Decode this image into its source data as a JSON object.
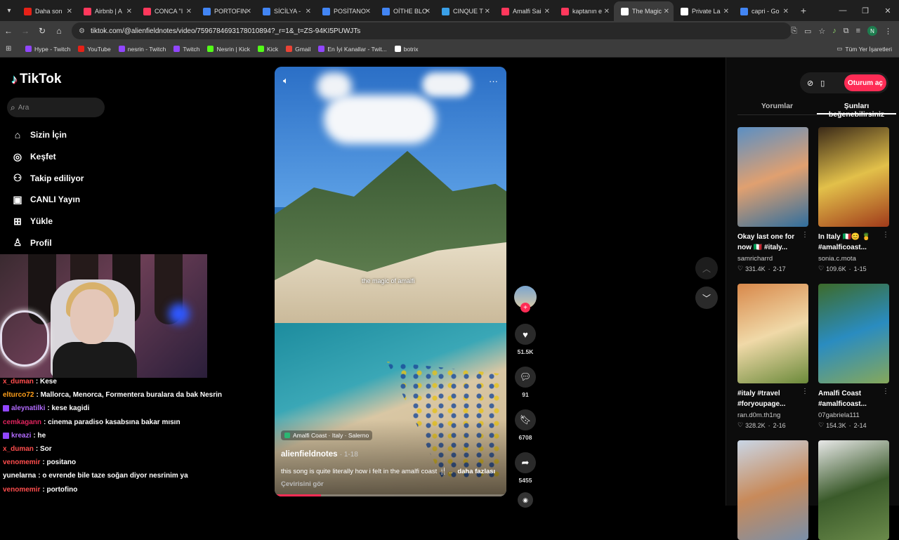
{
  "browser": {
    "tabs": [
      {
        "title": "Daha son",
        "color": "#e62117"
      },
      {
        "title": "Airbnb | A",
        "color": "#ff385c"
      },
      {
        "title": "CONCA \"I",
        "color": "#ff385c"
      },
      {
        "title": "PORTOFIN",
        "color": "#4285f4"
      },
      {
        "title": "SİCİLYA -",
        "color": "#4285f4"
      },
      {
        "title": "POSİTANO",
        "color": "#4285f4"
      },
      {
        "title": "OİTHE BLO",
        "color": "#4285f4"
      },
      {
        "title": "CINQUE T",
        "color": "#3aa0e8"
      },
      {
        "title": "Amalfi Sai",
        "color": "#ff385c"
      },
      {
        "title": "kaptanın e",
        "color": "#ff385c"
      },
      {
        "title": "The Magic",
        "color": "#ffffff"
      },
      {
        "title": "Private La",
        "color": "#ffffff"
      },
      {
        "title": "capri - Go",
        "color": "#4285f4"
      }
    ],
    "active_tab_index": 10,
    "url": "tiktok.com/@alienfieldnotes/video/7596784693178010894?_r=1&_t=ZS-94KI5PUWJTs",
    "profile_initial": "N",
    "bookmarks": [
      {
        "label": "Hype - Twitch",
        "color": "#9146ff"
      },
      {
        "label": "YouTube",
        "color": "#e62117"
      },
      {
        "label": "nesrin - Twitch",
        "color": "#9146ff"
      },
      {
        "label": "Twitch",
        "color": "#9146ff"
      },
      {
        "label": "Nesrin | Kick",
        "color": "#53fc18"
      },
      {
        "label": "Kick",
        "color": "#53fc18"
      },
      {
        "label": "Gmail",
        "color": "#ea4335"
      },
      {
        "label": "En İyi Kanallar - Twit...",
        "color": "#9146ff"
      },
      {
        "label": "botrix",
        "color": "#ffffff"
      }
    ],
    "all_bookmarks": "Tüm Yer İşaretleri"
  },
  "tiktok": {
    "logo": "TikTok",
    "search_placeholder": "Ara",
    "nav": [
      {
        "label": "Sizin İçin",
        "icon": "home-icon",
        "glyph": "⌂"
      },
      {
        "label": "Keşfet",
        "icon": "compass-icon",
        "glyph": "◎"
      },
      {
        "label": "Takip ediliyor",
        "icon": "following-icon",
        "glyph": "⚇"
      },
      {
        "label": "CANLI Yayın",
        "icon": "live-icon",
        "glyph": "▣"
      },
      {
        "label": "Yükle",
        "icon": "upload-icon",
        "glyph": "⊞"
      },
      {
        "label": "Profil",
        "icon": "profile-icon",
        "glyph": "♙"
      }
    ]
  },
  "chat": [
    {
      "user": "x_duman",
      "color": "#ff4d4d",
      "text": ": Kese",
      "badge": false
    },
    {
      "user": "elturco72",
      "color": "#ff9f1a",
      "text": ": Mallorca, Menorca, Formentera buralara da bak Nesrin",
      "badge": false
    },
    {
      "user": "aleynatilki",
      "color": "#b36bff",
      "text": ": kese kagidi",
      "badge": true
    },
    {
      "user": "cemkagann",
      "color": "#e0245e",
      "text": ": cinema paradiso kasabsına bakar mısın",
      "badge": false
    },
    {
      "user": "kreazi",
      "color": "#b36bff",
      "text": ": he",
      "badge": true
    },
    {
      "user": "x_duman",
      "color": "#ff4d4d",
      "text": ": Sor",
      "badge": false
    },
    {
      "user": "venomemir",
      "color": "#ff4d4d",
      "text": ": positano",
      "badge": false
    },
    {
      "user": "yunelarna",
      "color": "#ffffff",
      "text": ": o evrende bile taze soğan diyor nesrinim ya",
      "badge": false
    },
    {
      "user": "venomemir",
      "color": "#ff4d4d",
      "text": ": portofino",
      "badge": false
    }
  ],
  "video": {
    "overlay_text": "the magic of amalfi",
    "location": "Amalfi Coast · Italy · Salerno",
    "author": "alienfieldnotes",
    "date": "· 1-18",
    "description": "this song is quite literally how i felt in the amalfi coast 🍴 ..",
    "more": "daha fazlası",
    "translate": "Çevirisini gör",
    "progress": 0.2,
    "likes": "51.5K",
    "comments": "91",
    "saves": "6708",
    "shares": "5455"
  },
  "right_panel": {
    "login": "Oturum aç",
    "tabs": [
      "Yorumlar",
      "Şunları beğenebilirsiniz"
    ],
    "active_tab": 1,
    "cards": [
      {
        "title": "Okay last one for now 🇮🇹 #italy...",
        "user": "samricharrd",
        "likes": "331.4K",
        "date": "2-17",
        "colors": [
          "#5a8fc4",
          "#e0a070",
          "#2f6e9e"
        ]
      },
      {
        "title": "In Italy 🇮🇹😊 🍍 #amalficoast...",
        "user": "sonia.c.mota",
        "likes": "109.6K",
        "date": "1-15",
        "colors": [
          "#3b2a18",
          "#e2c04a",
          "#a03a1a"
        ]
      },
      {
        "title": "#italy #travel #foryoupage...",
        "user": "ran.d0m.th1ng",
        "likes": "328.2K",
        "date": "2-16",
        "colors": [
          "#d8884a",
          "#f0d9a8",
          "#6b8a3a"
        ]
      },
      {
        "title": "Amalfi Coast #amalficoast...",
        "user": "07gabriela111",
        "likes": "154.3K",
        "date": "2-14",
        "colors": [
          "#3d6b2a",
          "#2a8cc0",
          "#86a85a"
        ]
      },
      {
        "title": "",
        "user": "",
        "likes": "",
        "date": "",
        "colors": [
          "#c9d6e6",
          "#c88a5a",
          "#7a8fa8"
        ]
      },
      {
        "title": "",
        "user": "",
        "likes": "",
        "date": "",
        "colors": [
          "#e8e8e8",
          "#3a5a2a",
          "#6a8a4a"
        ]
      }
    ]
  }
}
